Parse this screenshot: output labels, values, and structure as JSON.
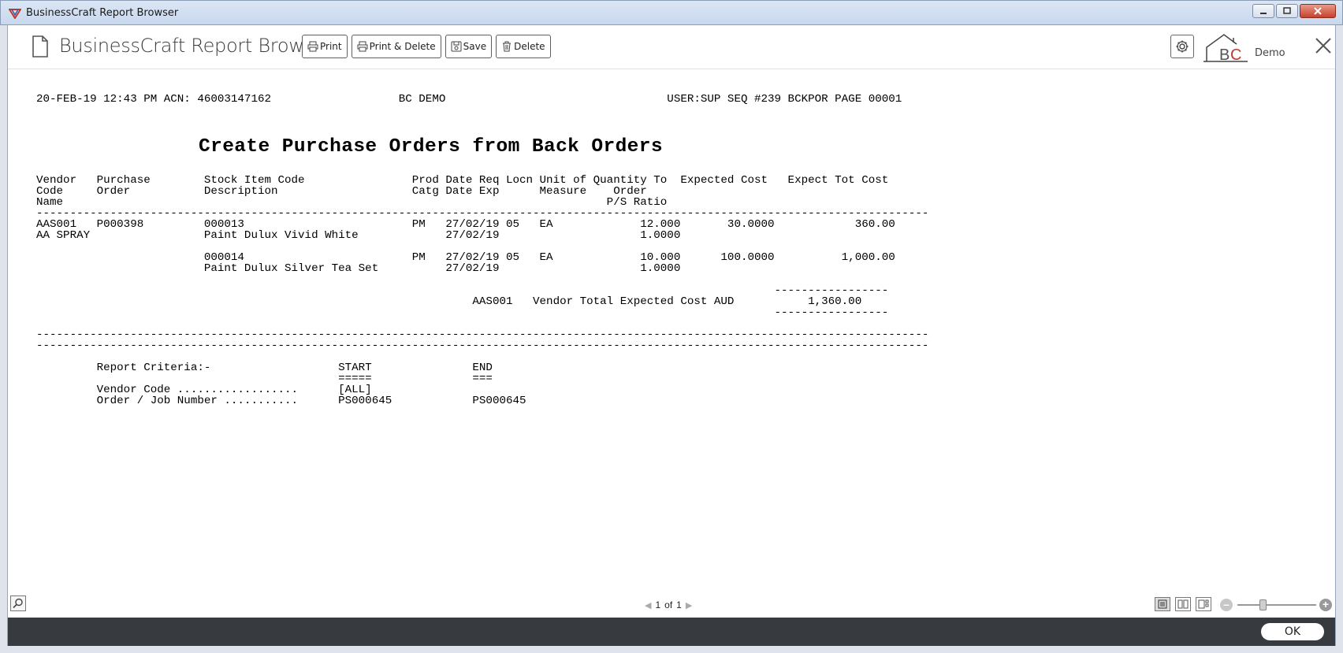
{
  "window": {
    "title": "BusinessCraft Report Browser"
  },
  "header": {
    "app_title": "BusinessCraft Report Browser",
    "buttons": {
      "print": "Print",
      "print_delete": "Print & Delete",
      "save": "Save",
      "delete": "Delete"
    },
    "logo_text": "BC",
    "demo_label": "Demo"
  },
  "report": {
    "header_line": "20-FEB-19 12:43 PM ACN: 46003147162                   BC DEMO                                 USER:SUP SEQ #239 BCKPOR PAGE 00001",
    "title": "Create Purchase Orders from Back Orders",
    "column_headers": "Vendor   Purchase        Stock Item Code                Prod Date Req Locn Unit of Quantity To  Expected Cost   Expect Tot Cost\nCode     Order           Description                    Catg Date Exp      Measure    Order\nName                                                                                 P/S Ratio\n-------------------------------------------------------------------------------------------------------------------------------------",
    "rows": "AAS001   P000398         000013                         PM   27/02/19 05   EA             12.000       30.0000            360.00\nAA SPRAY                 Paint Dulux Vivid White             27/02/19                     1.0000\n\n                         000014                         PM   27/02/19 05   EA             10.000      100.0000          1,000.00\n                         Paint Dulux Silver Tea Set          27/02/19                     1.0000\n\n                                                                                                              -----------------\n                                                                 AAS001   Vendor Total Expected Cost AUD           1,360.00\n                                                                                                              -----------------\n\n-------------------------------------------------------------------------------------------------------------------------------------\n-------------------------------------------------------------------------------------------------------------------------------------",
    "criteria": "         Report Criteria:-                   START               END\n                                             =====               ===\n         Vendor Code ..................      [ALL]\n         Order / Job Number ...........      PS000645            PS000645"
  },
  "status": {
    "page_current": "1",
    "page_of": "of",
    "page_total": "1"
  },
  "footer": {
    "ok_label": "OK"
  }
}
